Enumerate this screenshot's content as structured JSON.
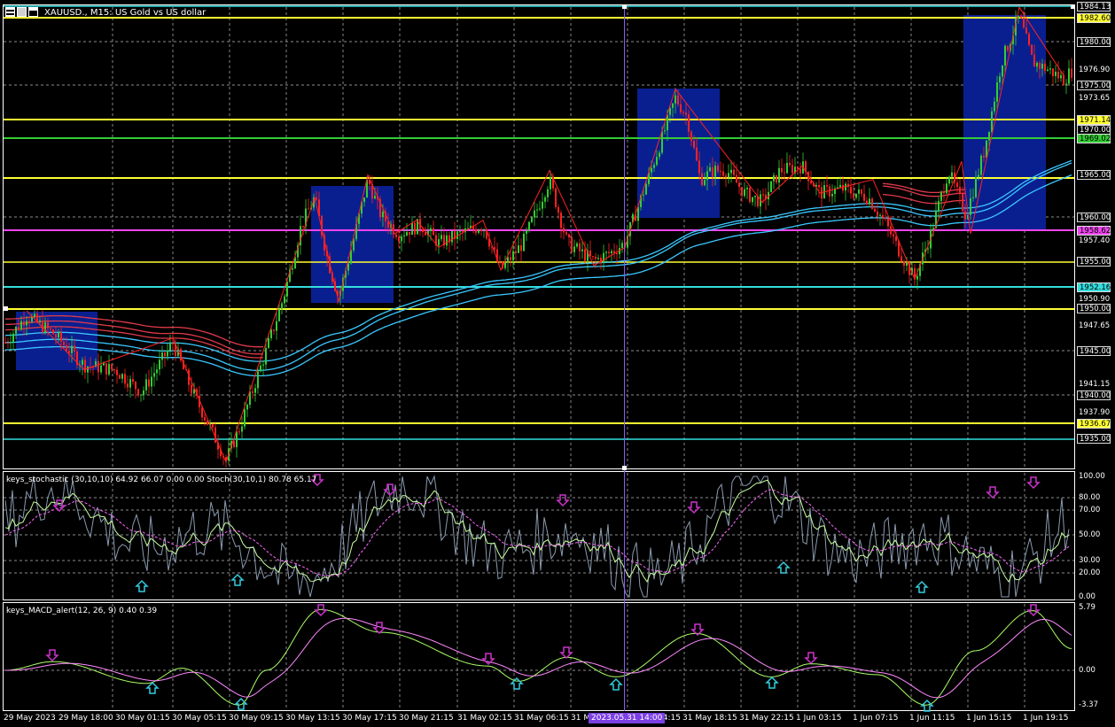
{
  "window": {
    "title": "XAUUSD., M15:  US Gold vs US dollar",
    "icons": [
      "menu-icon",
      "restore-icon",
      "maximize-icon"
    ]
  },
  "price_axis": [
    {
      "text": "1984.13",
      "style": "boxed",
      "color": "#ffffff",
      "bg": "#000000"
    },
    {
      "text": "1982.60",
      "style": "boxed",
      "color": "#000000",
      "bg": "#ffff33"
    },
    {
      "text": "1980.00",
      "style": "boxed",
      "color": "#ffffff",
      "bg": "#000000"
    },
    {
      "text": "1976.90",
      "style": "plain"
    },
    {
      "text": "1975.00",
      "style": "boxed",
      "color": "#ffffff",
      "bg": "#000000"
    },
    {
      "text": "1973.65",
      "style": "plain"
    },
    {
      "text": "1971.14",
      "style": "boxed",
      "color": "#000000",
      "bg": "#ffff33"
    },
    {
      "text": "1970.00",
      "style": "boxed",
      "color": "#ffffff",
      "bg": "#000000"
    },
    {
      "text": "1969.02",
      "style": "boxed",
      "color": "#000000",
      "bg": "#33cc33"
    },
    {
      "text": "1965.00",
      "style": "boxed",
      "color": "#ffffff",
      "bg": "#000000"
    },
    {
      "text": "1960.00",
      "style": "boxed",
      "color": "#ffffff",
      "bg": "#000000"
    },
    {
      "text": "1958.62",
      "style": "boxed",
      "color": "#000000",
      "bg": "#ee44ee"
    },
    {
      "text": "1957.40",
      "style": "plain"
    },
    {
      "text": "1955.00",
      "style": "boxed",
      "color": "#ffffff",
      "bg": "#000000"
    },
    {
      "text": "1952.16",
      "style": "boxed",
      "color": "#000000",
      "bg": "#33dddd"
    },
    {
      "text": "1950.90",
      "style": "plain"
    },
    {
      "text": "1950.00",
      "style": "boxed",
      "color": "#ffffff",
      "bg": "#000000"
    },
    {
      "text": "1947.65",
      "style": "plain"
    },
    {
      "text": "1945.00",
      "style": "boxed",
      "color": "#ffffff",
      "bg": "#000000"
    },
    {
      "text": "1941.15",
      "style": "plain"
    },
    {
      "text": "1940.00",
      "style": "boxed",
      "color": "#ffffff",
      "bg": "#000000"
    },
    {
      "text": "1937.90",
      "style": "plain"
    },
    {
      "text": "1936.67",
      "style": "boxed",
      "color": "#000000",
      "bg": "#ffff33"
    },
    {
      "text": "1935.00",
      "style": "boxed",
      "color": "#ffffff",
      "bg": "#000000"
    }
  ],
  "stochastic": {
    "title": "keys_stochastic (30,10,10) 64.92 66.07 0.00 0.00 Stoch(30,10,1) 80.78 65.17",
    "levels": [
      "100.00",
      "80.00",
      "70.00",
      "50.00",
      "30.00",
      "20.00",
      "0.00"
    ]
  },
  "macd": {
    "title": "keys_MACD_alert(12, 26, 9) 0.40 0.39",
    "levels": [
      "5.79",
      "0.00",
      "-3.37"
    ]
  },
  "time_axis": [
    "29 May 2023",
    "29 May 18:00",
    "30 May 01:15",
    "30 May 05:15",
    "30 May 09:15",
    "30 May 13:15",
    "30 May 17:15",
    "30 May 21:15",
    "31 May 02:15",
    "31 May 06:15",
    "31 M",
    "14:15",
    "31 May 18:15",
    "31 May 22:15",
    "1 Jun 03:15",
    "1 Jun 07:15",
    "1 Jun 11:15",
    "1 Jun 15:15",
    "1 Jun 19:15"
  ],
  "cursor_time": "2023.05.31 14:00",
  "colors": {
    "background": "#000000",
    "bull_candle": "#33cc33",
    "bear_candle": "#ff2222",
    "zone_box": "#0a1f8f",
    "ma_red": "#e03a4a",
    "ma_blue": "#3ac8ff",
    "stoch_main": "#c8ffa0",
    "stoch_signal": "#ff66ff",
    "macd_main": "#aaff66",
    "macd_signal": "#ff88ff",
    "arrow_down": "#cc33cc",
    "arrow_up": "#33ccdd",
    "cursor_line": "#8a5cf5"
  }
}
